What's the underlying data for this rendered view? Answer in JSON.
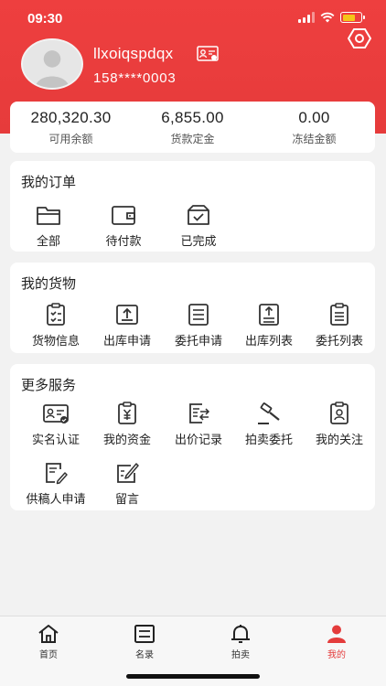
{
  "status_bar": {
    "time": "09:30"
  },
  "profile": {
    "username": "llxoiqspdqx",
    "phone": "158****0003"
  },
  "balances": [
    {
      "value": "280,320.30",
      "label": "可用余额"
    },
    {
      "value": "6,855.00",
      "label": "货款定金"
    },
    {
      "value": "0.00",
      "label": "冻结金额"
    }
  ],
  "orders": {
    "title": "我的订单",
    "items": [
      {
        "label": "全部",
        "icon": "folder-icon"
      },
      {
        "label": "待付款",
        "icon": "wallet-icon"
      },
      {
        "label": "已完成",
        "icon": "completed-box-icon"
      }
    ]
  },
  "goods": {
    "title": "我的货物",
    "items": [
      {
        "label": "货物信息",
        "icon": "clipboard-check-icon"
      },
      {
        "label": "出库申请",
        "icon": "upload-box-icon"
      },
      {
        "label": "委托申请",
        "icon": "list-document-icon"
      },
      {
        "label": "出库列表",
        "icon": "upload-list-icon"
      },
      {
        "label": "委托列表",
        "icon": "clipboard-list-icon"
      }
    ]
  },
  "services": {
    "title": "更多服务",
    "items": [
      {
        "label": "实名认证",
        "icon": "id-card-icon"
      },
      {
        "label": "我的资金",
        "icon": "yuan-clipboard-icon"
      },
      {
        "label": "出价记录",
        "icon": "bid-record-icon"
      },
      {
        "label": "拍卖委托",
        "icon": "gavel-icon"
      },
      {
        "label": "我的关注",
        "icon": "badge-person-icon"
      },
      {
        "label": "供稿人申请",
        "icon": "edit-document-icon"
      },
      {
        "label": "留言",
        "icon": "message-edit-icon"
      }
    ]
  },
  "tabbar": {
    "items": [
      {
        "label": "首页",
        "icon": "home-icon"
      },
      {
        "label": "名录",
        "icon": "list-icon"
      },
      {
        "label": "拍卖",
        "icon": "bell-icon"
      },
      {
        "label": "我的",
        "icon": "person-icon",
        "active": true
      }
    ]
  },
  "colors": {
    "brand": "#e63b3b",
    "active_tab": "#e43c3c"
  }
}
